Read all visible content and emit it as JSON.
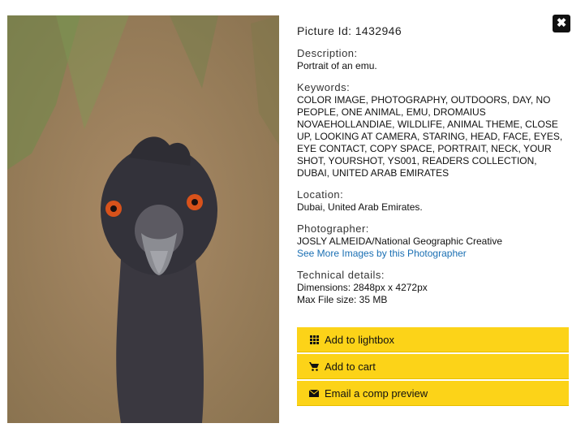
{
  "picture": {
    "id_label": "Picture Id: 1432946"
  },
  "description": {
    "label": "Description:",
    "value": "Portrait of an emu."
  },
  "keywords": {
    "label": "Keywords:",
    "value": "COLOR IMAGE, PHOTOGRAPHY, OUTDOORS, DAY, NO PEOPLE, ONE ANIMAL, EMU, DROMAIUS NOVAEHOLLANDIAE, WILDLIFE, ANIMAL THEME, CLOSE UP, LOOKING AT CAMERA, STARING, HEAD, FACE, EYES, EYE CONTACT, COPY SPACE, PORTRAIT, NECK, YOUR SHOT, YOURSHOT, YS001, READERS COLLECTION, DUBAI, UNITED ARAB EMIRATES"
  },
  "location": {
    "label": "Location:",
    "value": "Dubai, United Arab Emirates."
  },
  "photographer": {
    "label": "Photographer:",
    "value": "JOSLY ALMEIDA/National Geographic Creative",
    "link": "See More Images by this Photographer"
  },
  "technical": {
    "label": "Technical details:",
    "dimensions": "Dimensions: 2848px x 4272px",
    "filesize": "Max File size: 35 MB"
  },
  "actions": {
    "lightbox": "Add to lightbox",
    "cart": "Add to cart",
    "email": "Email a comp preview"
  },
  "icons": {
    "close": "close-icon",
    "lightbox": "grid-icon",
    "cart": "cart-icon",
    "email": "envelope-icon"
  },
  "colors": {
    "button_bg": "#fcd318",
    "link": "#1a6fb3",
    "close_bg": "#111111"
  }
}
